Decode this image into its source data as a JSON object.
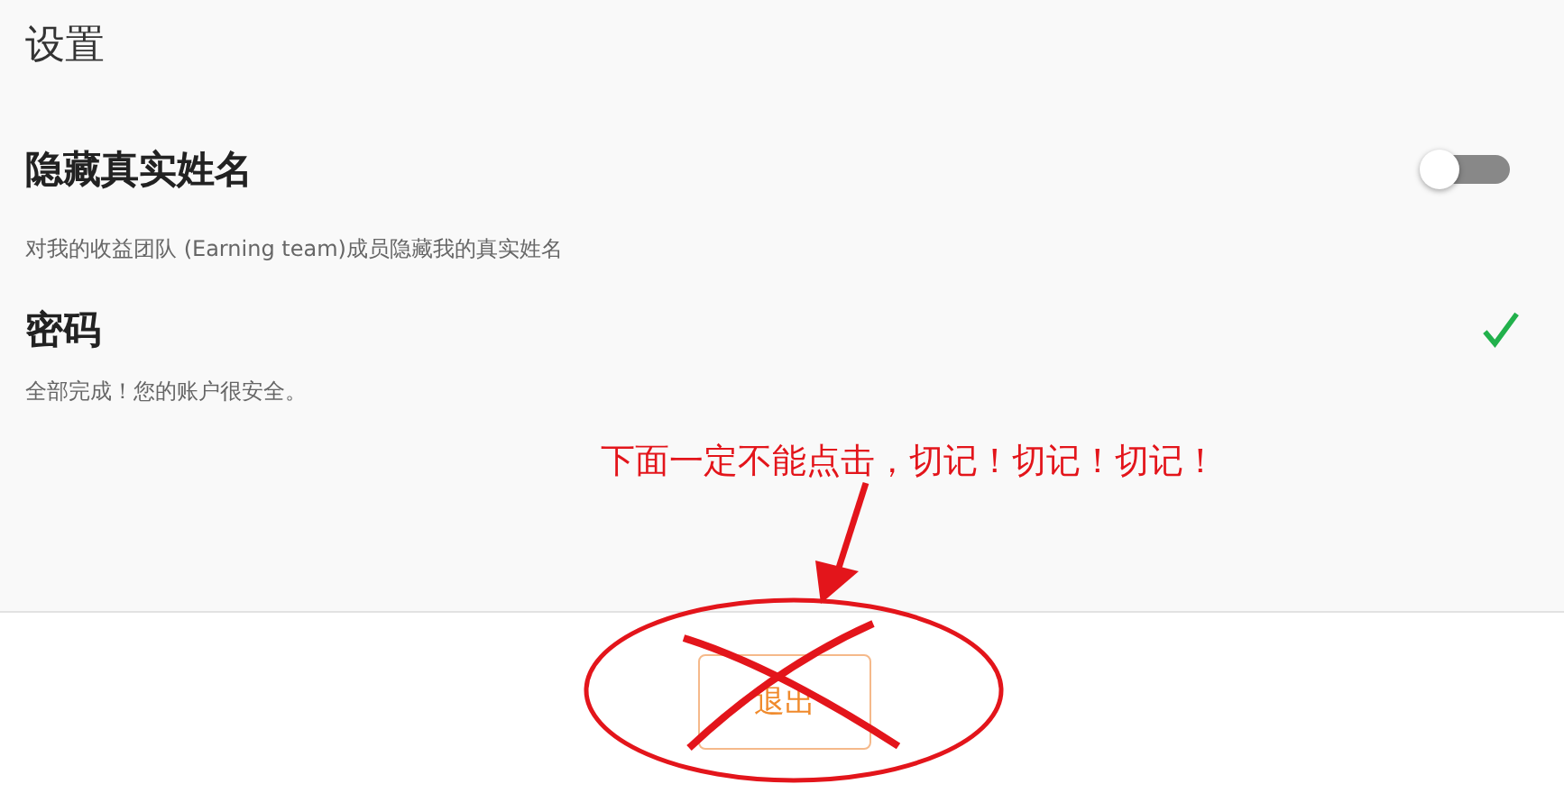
{
  "page": {
    "title": "设置"
  },
  "settings": [
    {
      "kind": "toggle",
      "label": "隐藏真实姓名",
      "description": "对我的收益团队 (Earning team)成员隐藏我的真实姓名",
      "on": false
    },
    {
      "kind": "status",
      "label": "密码",
      "description": "全部完成！您的账户很安全。",
      "done": true
    }
  ],
  "logout_button": {
    "label": "退出"
  },
  "annotation": {
    "text": "下面一定不能点击，切记！切记！切记！"
  }
}
